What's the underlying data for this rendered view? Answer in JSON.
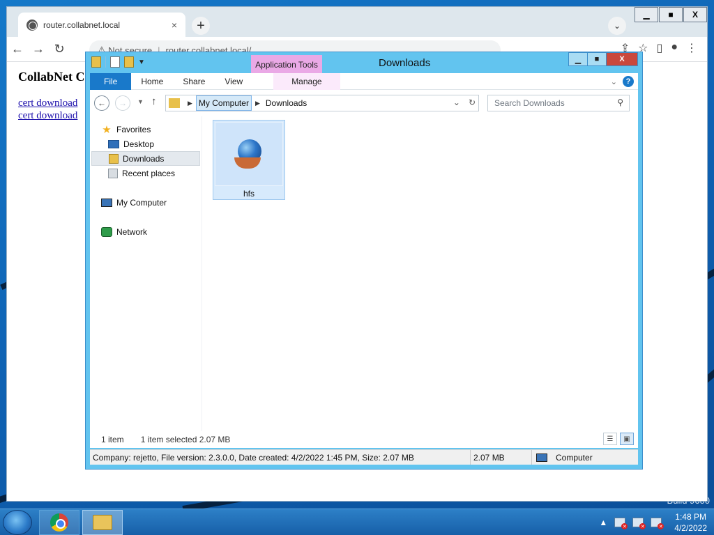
{
  "desktop": {
    "build_text": "Build 9600"
  },
  "chrome": {
    "tab_title": "router.collabnet.local",
    "tab_close": "×",
    "new_tab": "+",
    "tab_search": "⌄",
    "win_minimize": "▁",
    "win_maximize": "■",
    "win_close": "X",
    "not_secure": "Not secure",
    "url": "router.collabnet.local/",
    "page_heading": "CollabNet C",
    "links": [
      "cert download",
      "cert download"
    ]
  },
  "explorer": {
    "title": "Downloads",
    "app_tools": "Application Tools",
    "ribbon_tabs": [
      "File",
      "Home",
      "Share",
      "View",
      "Manage"
    ],
    "help": "?",
    "breadcrumbs": [
      "My Computer",
      "Downloads"
    ],
    "search_placeholder": "Search Downloads",
    "nav": {
      "favorites": "Favorites",
      "desktop": "Desktop",
      "downloads": "Downloads",
      "recent": "Recent places",
      "my_computer": "My Computer",
      "network": "Network"
    },
    "files": [
      {
        "name": "hfs"
      }
    ],
    "status": {
      "count": "1 item",
      "selected": "1 item selected  2.07 MB"
    },
    "details": {
      "info": "Company: rejetto, File version: 2.3.0.0, Date created: 4/2/2022 1:45 PM, Size: 2.07 MB",
      "size": "2.07 MB",
      "location": "Computer"
    }
  },
  "taskbar": {
    "time": "1:48 PM",
    "date": "4/2/2022"
  }
}
